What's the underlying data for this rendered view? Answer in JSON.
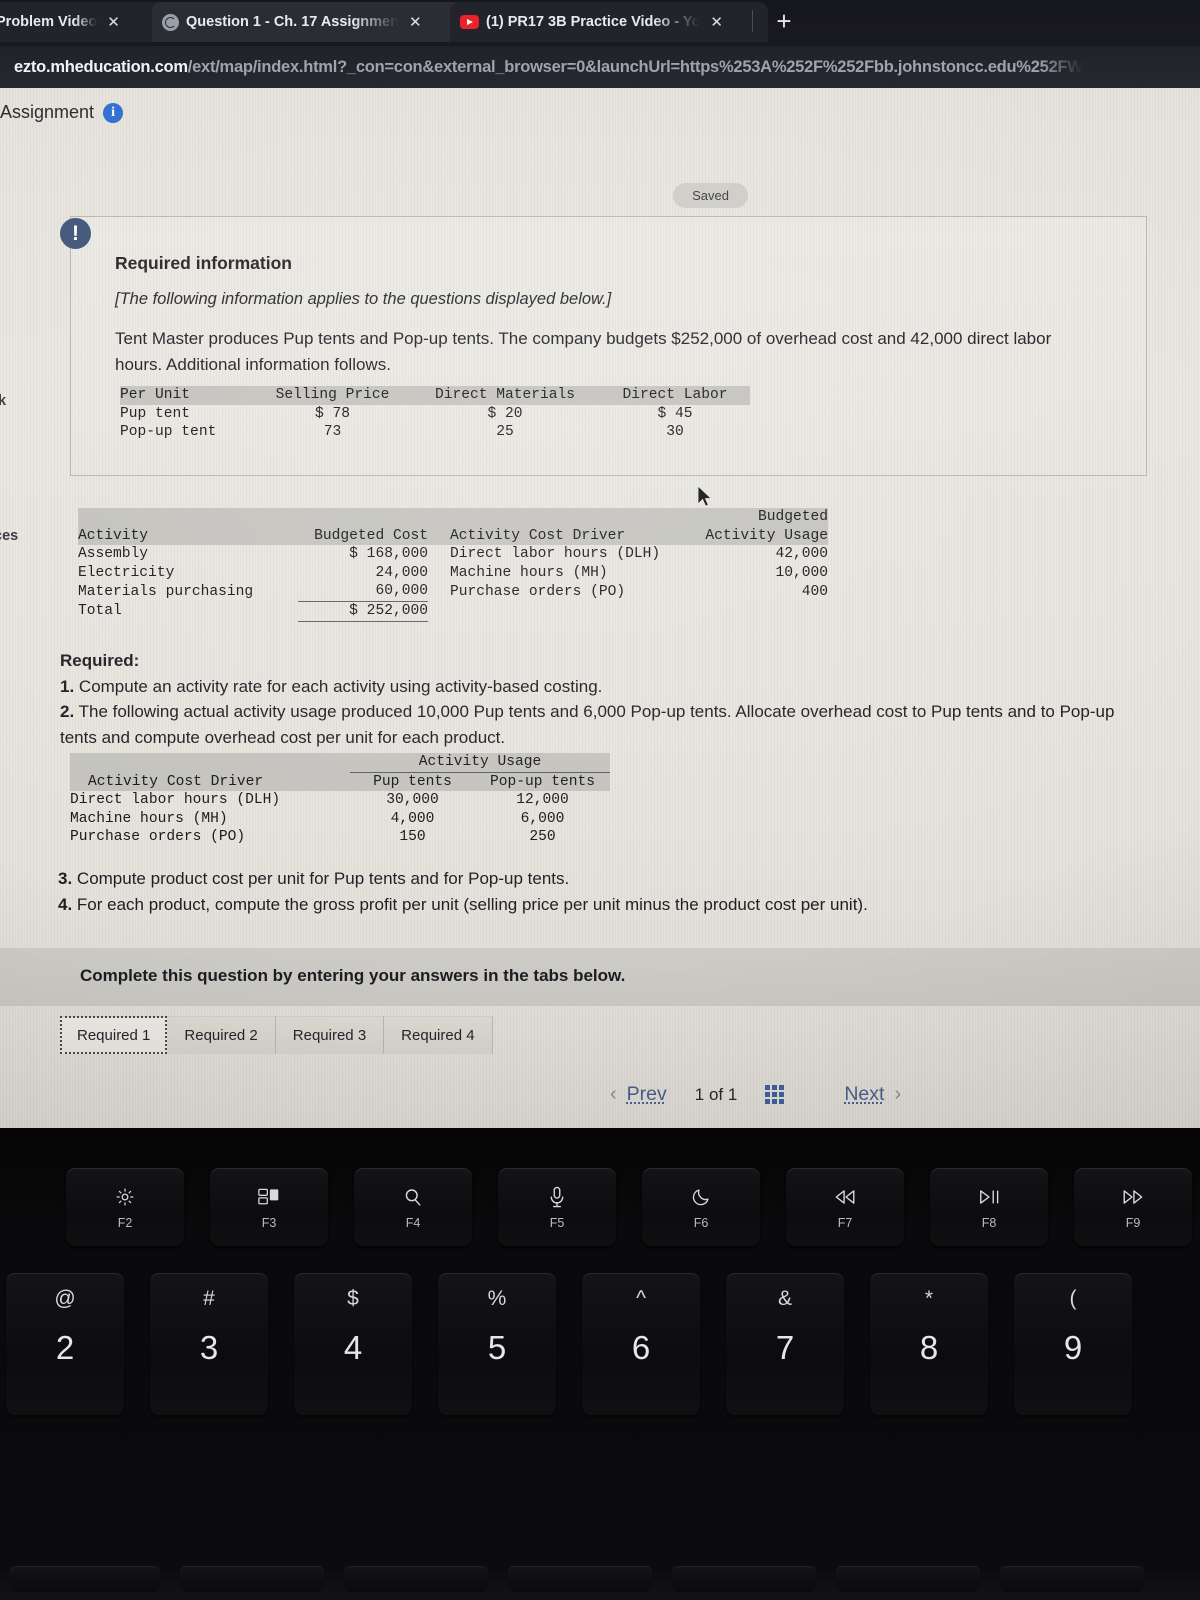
{
  "browser": {
    "tabs": [
      {
        "title": "Problem Video",
        "favicon": "none",
        "active": false
      },
      {
        "title": "Question 1 - Ch. 17 Assignmen",
        "favicon": "globe-icon",
        "active": true
      },
      {
        "title": "(1) PR17 3B Practice Video - Yo",
        "favicon": "youtube-icon",
        "active": false
      }
    ],
    "new_tab_label": "+",
    "close_label": "✕",
    "url_domain": "ezto.mheducation.com",
    "url_path": "/ext/map/index.html?_con=con&external_browser=0&launchUrl=https%253A%252F%252Fbb.johnstoncc.edu%252FW"
  },
  "header": {
    "title": "Assignment",
    "info_icon": "info-icon",
    "saved_badge": "Saved"
  },
  "sidebar_slivers": [
    {
      "text": "k"
    },
    {
      "text": "ces"
    }
  ],
  "required_info": {
    "alert_icon": "exclamation-icon",
    "title": "Required information",
    "subtitle": "[The following information applies to the questions displayed below.]",
    "paragraph": "Tent Master produces Pup tents and Pop-up tents. The company budgets $252,000 of overhead cost and 42,000 direct labor hours. Additional information follows."
  },
  "per_unit_table": {
    "headers": [
      "Per Unit",
      "Selling Price",
      "Direct Materials",
      "Direct Labor"
    ],
    "rows": [
      [
        "Pup tent",
        "$ 78",
        "$ 20",
        "$ 45"
      ],
      [
        "Pop-up tent",
        "73",
        "25",
        "30"
      ]
    ]
  },
  "activity_table": {
    "headers": [
      "Activity",
      "Budgeted Cost",
      "Activity Cost Driver",
      "Budgeted",
      "Activity Usage"
    ],
    "rows": [
      [
        "Assembly",
        "$ 168,000",
        "Direct labor hours (DLH)",
        "42,000"
      ],
      [
        "Electricity",
        "24,000",
        "Machine hours (MH)",
        "10,000"
      ],
      [
        "Materials purchasing",
        "60,000",
        "Purchase orders (PO)",
        "400"
      ]
    ],
    "total_label": "Total",
    "total_value": "$ 252,000"
  },
  "required_list": {
    "heading": "Required:",
    "items": [
      {
        "num": "1.",
        "text": " Compute an activity rate for each activity using activity-based costing."
      },
      {
        "num": "2.",
        "text": " The following actual activity usage produced 10,000 Pup tents and 6,000 Pop-up tents. Allocate overhead cost to Pup tents and to Pop-up tents and compute overhead cost per unit for each product."
      }
    ],
    "items2": [
      {
        "num": "3.",
        "text": " Compute product cost per unit for Pup tents and for Pop-up tents."
      },
      {
        "num": "4.",
        "text": " For each product, compute the gross profit per unit (selling price per unit minus the product cost per unit)."
      }
    ]
  },
  "usage_table": {
    "group_header": "Activity Usage",
    "headers": [
      "Activity Cost Driver",
      "Pup tents",
      "Pop-up tents"
    ],
    "rows": [
      [
        "Direct labor hours (DLH)",
        "30,000",
        "12,000"
      ],
      [
        "Machine hours (MH)",
        "4,000",
        "6,000"
      ],
      [
        "Purchase orders (PO)",
        "150",
        "250"
      ]
    ]
  },
  "banner": {
    "text": "Complete this question by entering your answers in the tabs below."
  },
  "answer_tabs": [
    {
      "label": "Required 1",
      "selected": true
    },
    {
      "label": "Required 2",
      "selected": false
    },
    {
      "label": "Required 3",
      "selected": false
    },
    {
      "label": "Required 4",
      "selected": false
    }
  ],
  "pager": {
    "prev_chevron": "‹",
    "prev_label": "Prev",
    "count_label": "1 of 1",
    "grid_icon": "grid-icon",
    "next_label": "Next",
    "next_chevron": "›"
  },
  "keyboard": {
    "function_keys": [
      {
        "glyph": "☼",
        "label": "F2",
        "icon": "brightness-icon"
      },
      {
        "glyph": "▤",
        "label": "F3",
        "icon": "mission-control-icon"
      },
      {
        "glyph": "⌕",
        "label": "F4",
        "icon": "search-icon"
      },
      {
        "glyph": "\u0001",
        "label": "F5",
        "icon": "microphone-icon"
      },
      {
        "glyph": "☾",
        "label": "F6",
        "icon": "do-not-disturb-icon"
      },
      {
        "glyph": "⏪",
        "label": "F7",
        "icon": "rewind-icon"
      },
      {
        "glyph": "⏯",
        "label": "F8",
        "icon": "play-pause-icon"
      },
      {
        "glyph": "⏩",
        "label": "F9",
        "icon": "fast-forward-icon"
      }
    ],
    "number_keys": [
      {
        "sym": "@",
        "num": "2"
      },
      {
        "sym": "#",
        "num": "3"
      },
      {
        "sym": "$",
        "num": "4"
      },
      {
        "sym": "%",
        "num": "5"
      },
      {
        "sym": "^",
        "num": "6"
      },
      {
        "sym": "&",
        "num": "7"
      },
      {
        "sym": "*",
        "num": "8"
      },
      {
        "sym": "(",
        "num": "9"
      }
    ]
  },
  "colors": {
    "alert_badge": "#3f5578",
    "info_icon": "#2f6fd0",
    "link": "#4a5e8c",
    "grid_icon": "#3f5f9e",
    "page_bg": "#e6e3dd",
    "table_header": "#c3c2bd"
  }
}
